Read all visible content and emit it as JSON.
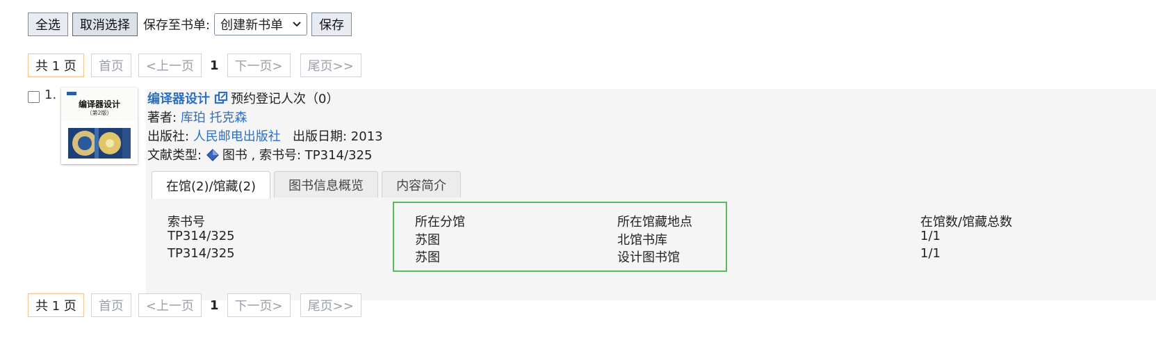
{
  "toolbar": {
    "select_all": "全选",
    "deselect": "取消选择",
    "save_to_label": "保存至书单:",
    "booklist_selected": "创建新书单",
    "save": "保存"
  },
  "pager": {
    "total": "共 1 页",
    "first": "首页",
    "prev": "<上一页",
    "current": "1",
    "next": "下一页>",
    "last": "尾页>>"
  },
  "result": {
    "index": "1.",
    "cover_title": "编译器设计",
    "cover_edition": "（第2版）",
    "title": "编译器设计",
    "reservations": "预约登记人次（0）",
    "author_label": "著者:",
    "author": "库珀 托克森",
    "publisher_label": "出版社:",
    "publisher": "人民邮电出版社",
    "pubdate_label": "出版日期:",
    "pubdate": "2013",
    "doctype_label": "文献类型:",
    "doctype": "图书",
    "callno_label": ", 索书号:",
    "callno": "TP314/325"
  },
  "tabs": [
    {
      "label": "在馆(2)/馆藏(2)"
    },
    {
      "label": "图书信息概览"
    },
    {
      "label": "内容简介"
    }
  ],
  "holdings": {
    "headers": [
      "索书号",
      "所在分馆",
      "所在馆藏地点",
      "在馆数/馆藏总数"
    ],
    "rows": [
      [
        "TP314/325",
        "苏图",
        "北馆书库",
        "1/1"
      ],
      [
        "TP314/325",
        "苏图",
        "设计图书馆",
        "1/1"
      ]
    ]
  }
}
